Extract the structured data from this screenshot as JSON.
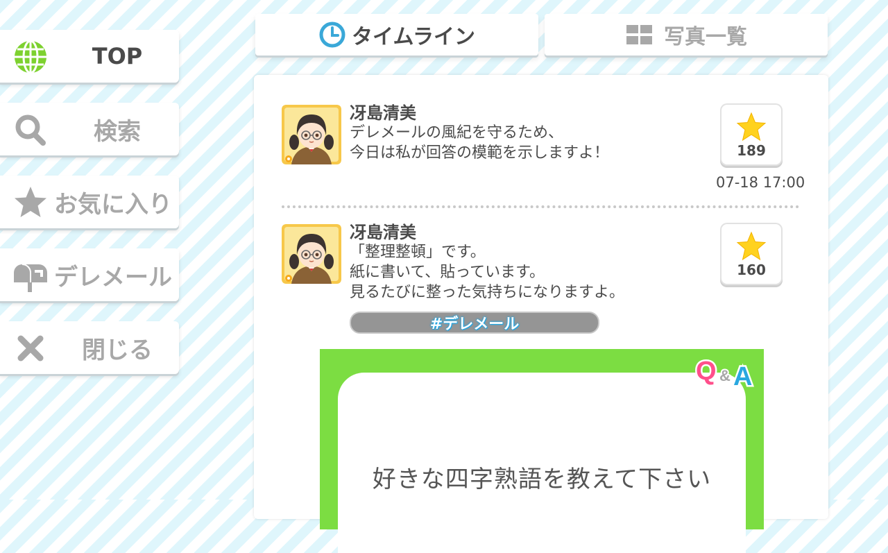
{
  "sidebar": {
    "items": [
      {
        "label": "TOP",
        "icon": "globe-icon",
        "active": true
      },
      {
        "label": "検索",
        "icon": "search-icon",
        "active": false
      },
      {
        "label": "お気に入り",
        "icon": "star-icon",
        "active": false
      },
      {
        "label": "デレメール",
        "icon": "mailbox-icon",
        "active": false
      },
      {
        "label": "閉じる",
        "icon": "close-icon",
        "active": false
      }
    ]
  },
  "tabs": [
    {
      "label": "タイムライン",
      "icon": "clock-icon",
      "active": true
    },
    {
      "label": "写真一覧",
      "icon": "grid-icon",
      "active": false
    }
  ],
  "posts": [
    {
      "author": "冴島清美",
      "message": "デレメールの風紀を守るため、\n今日は私が回答の模範を示しますよ！",
      "likes": "189",
      "timestamp": "07-18 17:00"
    },
    {
      "author": "冴島清美",
      "message": "「整理整頓」です。\n紙に書いて、貼っています。\n見るたびに整った気持ちになりますよ。",
      "likes": "160",
      "hashtag": "#デレメール",
      "qa_card": {
        "badge": "Q&A",
        "question": "好きな四字熟語を教えて下さい"
      }
    }
  ],
  "colors": {
    "qa_green": "#7cdd42",
    "globe_green": "#7dd12f",
    "clock_blue": "#3aa8d8",
    "star_yellow": "#ffd21f",
    "hashtag_glow": "#1aa7e8"
  }
}
